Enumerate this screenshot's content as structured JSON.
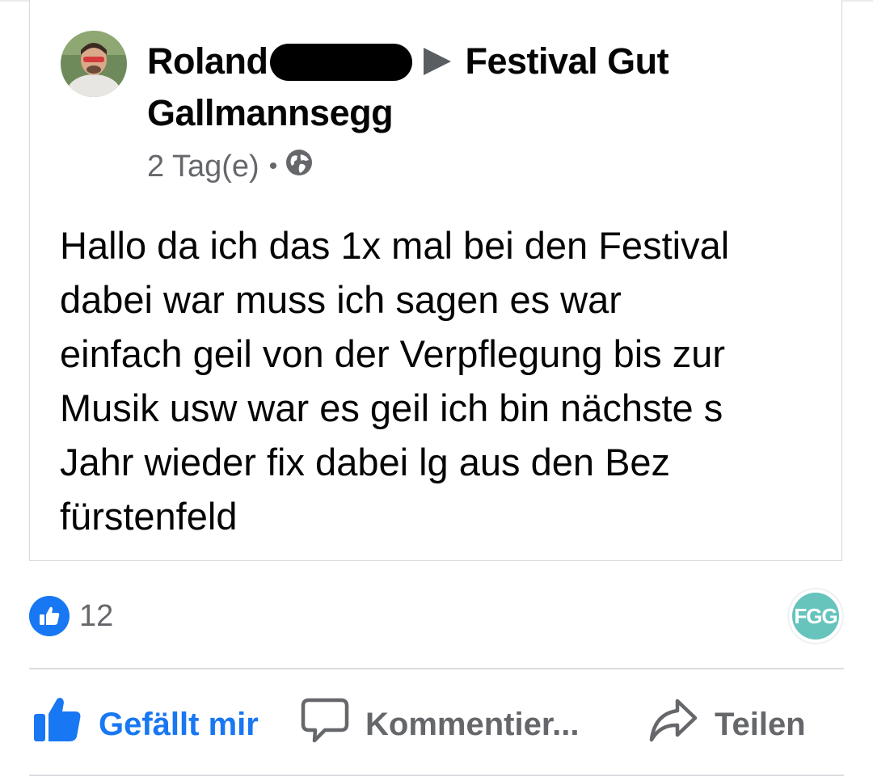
{
  "post": {
    "author_first_name": "Roland",
    "target_page": "Festival Gut Gallmannsegg",
    "time": "2 Tag(e)",
    "separator": "•",
    "audience_icon": "globe-icon",
    "text": "Hallo da ich das 1x mal bei den Festival\ndabei war muss ich sagen es war\neinfach geil von der Verpflegung bis zur\nMusik usw war es geil ich bin nächste s\nJahr wieder fix dabei lg aus den Bez\nfürstenfeld"
  },
  "reactions": {
    "icon": "thumbs-up-icon",
    "count": "12"
  },
  "page_avatar": {
    "text": "FGG",
    "color": "#66c4bd"
  },
  "actions": {
    "like_label": "Gefällt mir",
    "comment_label": "Kommentier...",
    "share_label": "Teilen"
  },
  "colors": {
    "accent": "#1877f2",
    "secondary_text": "#65676b",
    "primary_text": "#050505"
  }
}
